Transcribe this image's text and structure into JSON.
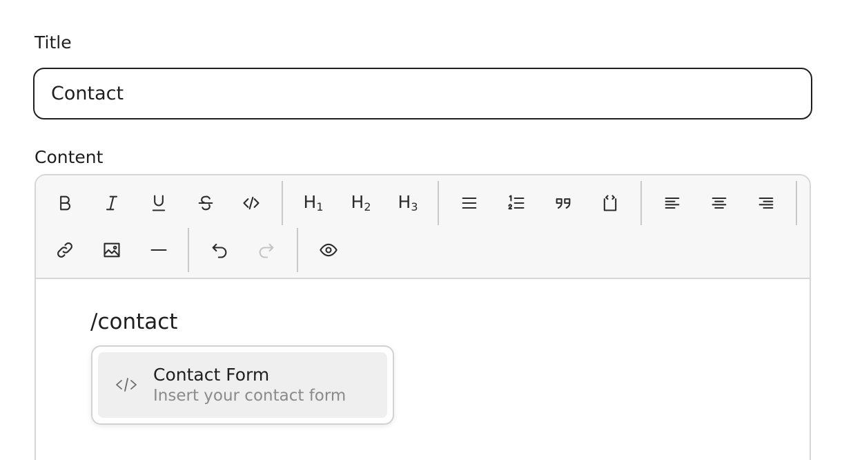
{
  "form": {
    "title_label": "Title",
    "title_value": "Contact",
    "content_label": "Content"
  },
  "toolbar": {
    "h1": {
      "letter": "H",
      "num": "1"
    },
    "h2": {
      "letter": "H",
      "num": "2"
    },
    "h3": {
      "letter": "H",
      "num": "3"
    },
    "icons": {
      "bold": "bold-icon",
      "italic": "italic-icon",
      "underline": "underline-icon",
      "strike": "strikethrough-icon",
      "code": "code-icon",
      "bullet_list": "bullet-list-icon",
      "ordered_list": "ordered-list-icon",
      "blockquote": "quote-icon",
      "code_block": "code-block-icon",
      "align_left": "align-left-icon",
      "align_center": "align-center-icon",
      "align_right": "align-right-icon",
      "link": "link-icon",
      "image": "image-icon",
      "horizontal_rule": "horizontal-rule-icon",
      "undo": "undo-icon",
      "redo": "redo-icon",
      "preview": "eye-icon"
    }
  },
  "editor": {
    "typed_text": "/contact"
  },
  "suggestions": [
    {
      "title": "Contact Form",
      "description": "Insert your contact form",
      "icon": "code-icon"
    }
  ],
  "colors": {
    "border": "#1f1f1f",
    "toolbar_bg": "#f7f7f7",
    "highlight_bg": "#efefef",
    "muted_text": "#8a8a8a"
  }
}
